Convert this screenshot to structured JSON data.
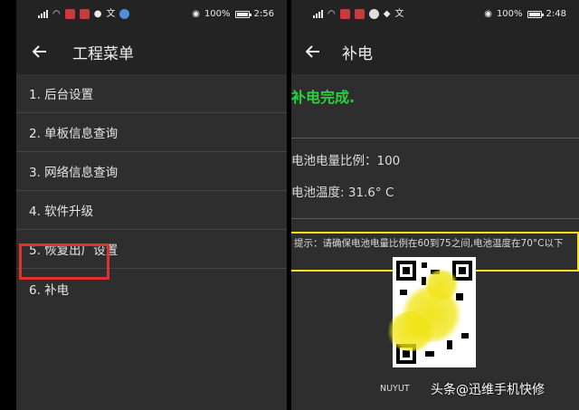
{
  "left": {
    "status": {
      "battery": "100%",
      "time": "2:56"
    },
    "appbar": {
      "title": "工程菜单"
    },
    "menu": [
      {
        "label": "1. 后台设置"
      },
      {
        "label": "2. 单板信息查询"
      },
      {
        "label": "3. 网络信息查询"
      },
      {
        "label": "4. 软件升级"
      },
      {
        "label": "5. 恢复出厂设置"
      },
      {
        "label": "6. 补电"
      }
    ]
  },
  "right": {
    "status": {
      "battery": "100%",
      "time": "2:48"
    },
    "appbar": {
      "title": "补电"
    },
    "done_text": "补电完成.",
    "battery_ratio": "电池电量比例：100",
    "battery_temp": "电池温度: 31.6° C",
    "tip": "提示：请确保电池电量比例在60到75之间,电池温度在70°C以下",
    "caption": "NUYUT",
    "watermark": "头条@迅维手机快修"
  },
  "colors": {
    "highlight": "#e0312c",
    "tip_border": "#f2e418",
    "done_green": "#27d23e"
  }
}
